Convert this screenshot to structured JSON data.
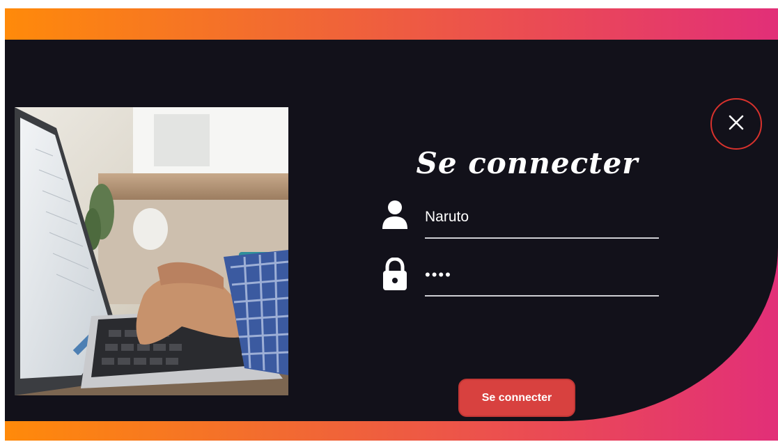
{
  "login": {
    "title": "Se connecter",
    "username_value": "Naruto",
    "password_value": "1234",
    "submit_label": "Se connecter"
  },
  "icons": {
    "close": "close-icon",
    "user": "user-icon",
    "lock": "lock-icon"
  },
  "colors": {
    "panel_background": "#12111a",
    "gradient_start": "#ff8a0a",
    "gradient_end": "#e22f78",
    "accent_red": "#d8413f"
  }
}
